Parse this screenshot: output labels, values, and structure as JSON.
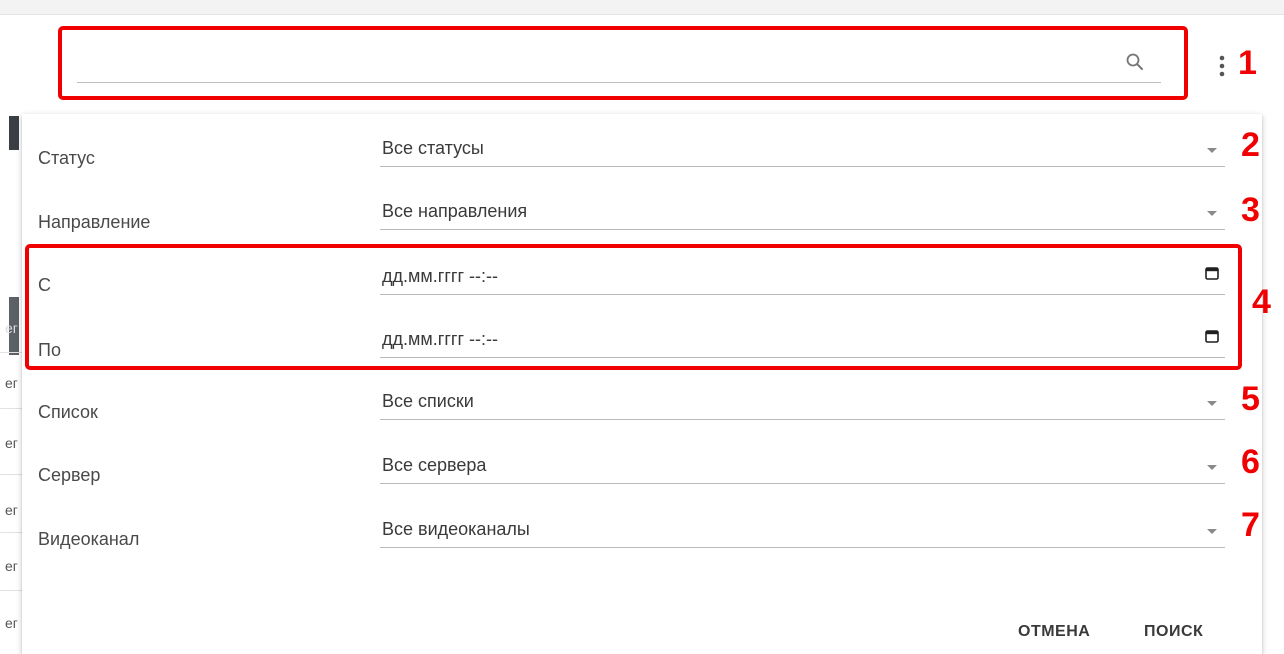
{
  "search": {
    "value": "",
    "placeholder": ""
  },
  "filters": [
    {
      "label": "Статус",
      "value": "Все статусы"
    },
    {
      "label": "Направление",
      "value": "Все направления"
    },
    {
      "label": "С",
      "value": "дд.мм.гггг --:--"
    },
    {
      "label": "По",
      "value": "дд.мм.гггг --:--"
    },
    {
      "label": "Список",
      "value": "Все списки"
    },
    {
      "label": "Сервер",
      "value": "Все сервера"
    },
    {
      "label": "Видеоканал",
      "value": "Все видеоканалы"
    }
  ],
  "buttons": {
    "cancel": "ОТМЕНА",
    "search": "ПОИСК"
  },
  "annotations": [
    "1",
    "2",
    "3",
    "4",
    "5",
    "6",
    "7"
  ],
  "background_fragments": [
    "ег",
    "ег",
    "ег",
    "ег",
    "ег",
    "ег",
    "ег"
  ],
  "icons": {
    "search": "search-icon",
    "more": "more-vert-icon",
    "dropdown": "chevron-down-icon",
    "calendar": "calendar-icon"
  },
  "colors": {
    "annotation": "#f00000",
    "text": "#3a3a3a"
  }
}
